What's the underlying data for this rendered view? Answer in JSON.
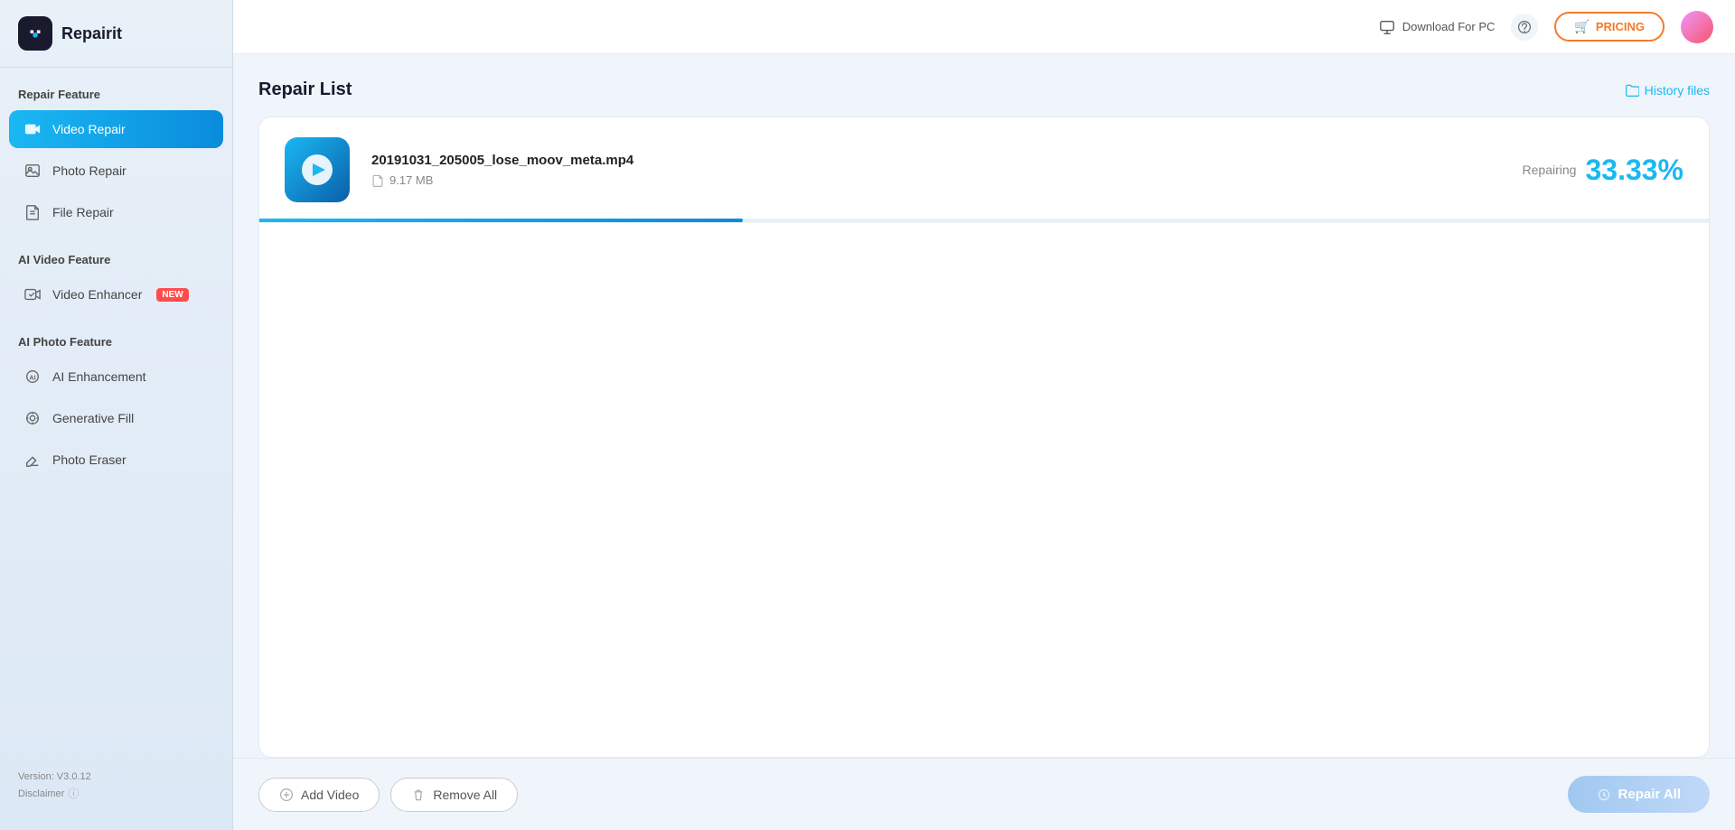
{
  "app": {
    "name": "Repairit"
  },
  "sidebar": {
    "repair_feature_section": "Repair Feature",
    "ai_video_section": "AI Video Feature",
    "ai_photo_section": "AI Photo Feature",
    "items": [
      {
        "id": "video-repair",
        "label": "Video Repair",
        "active": true
      },
      {
        "id": "photo-repair",
        "label": "Photo Repair",
        "active": false
      },
      {
        "id": "file-repair",
        "label": "File Repair",
        "active": false
      },
      {
        "id": "video-enhancer",
        "label": "Video Enhancer",
        "active": false,
        "badge": "NEW"
      },
      {
        "id": "ai-enhancement",
        "label": "AI Enhancement",
        "active": false
      },
      {
        "id": "generative-fill",
        "label": "Generative Fill",
        "active": false
      },
      {
        "id": "photo-eraser",
        "label": "Photo Eraser",
        "active": false
      }
    ],
    "version": "Version: V3.0.12",
    "disclaimer": "Disclaimer"
  },
  "topbar": {
    "download_label": "Download For PC",
    "pricing_label": "PRICING"
  },
  "main": {
    "title": "Repair List",
    "history_label": "History files"
  },
  "file": {
    "name": "20191031_205005_lose_moov_meta.mp4",
    "size": "9.17 MB",
    "status": "Repairing",
    "percent": "33.33%",
    "progress": 33.33
  },
  "bottombar": {
    "add_video": "Add Video",
    "remove_all": "Remove All",
    "repair_all": "Repair All"
  }
}
